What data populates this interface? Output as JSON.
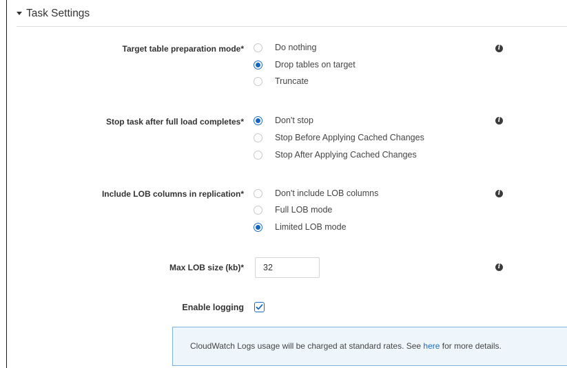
{
  "section": {
    "title": "Task Settings"
  },
  "prep_mode": {
    "label": "Target table preparation mode*",
    "options": [
      "Do nothing",
      "Drop tables on target",
      "Truncate"
    ],
    "selected": "Drop tables on target"
  },
  "stop_task": {
    "label": "Stop task after full load completes*",
    "options": [
      "Don't stop",
      "Stop Before Applying Cached Changes",
      "Stop After Applying Cached Changes"
    ],
    "selected": "Don't stop"
  },
  "lob_columns": {
    "label": "Include LOB columns in replication*",
    "options": [
      "Don't include LOB columns",
      "Full LOB mode",
      "Limited LOB mode"
    ],
    "selected": "Limited LOB mode"
  },
  "max_lob": {
    "label": "Max LOB size (kb)*",
    "value": "32"
  },
  "logging": {
    "label": "Enable logging",
    "checked": true
  },
  "notice": {
    "before": "CloudWatch Logs usage will be charged at standard rates. See ",
    "link": "here",
    "after": " for more details."
  },
  "icons": {
    "info": "info-icon",
    "caret": "caret-down-icon",
    "check": "checkmark-icon"
  },
  "colors": {
    "accent": "#1565c0",
    "link": "#1a6bc0",
    "notice_bg": "#eef5fb",
    "notice_border": "#7fb2df"
  }
}
